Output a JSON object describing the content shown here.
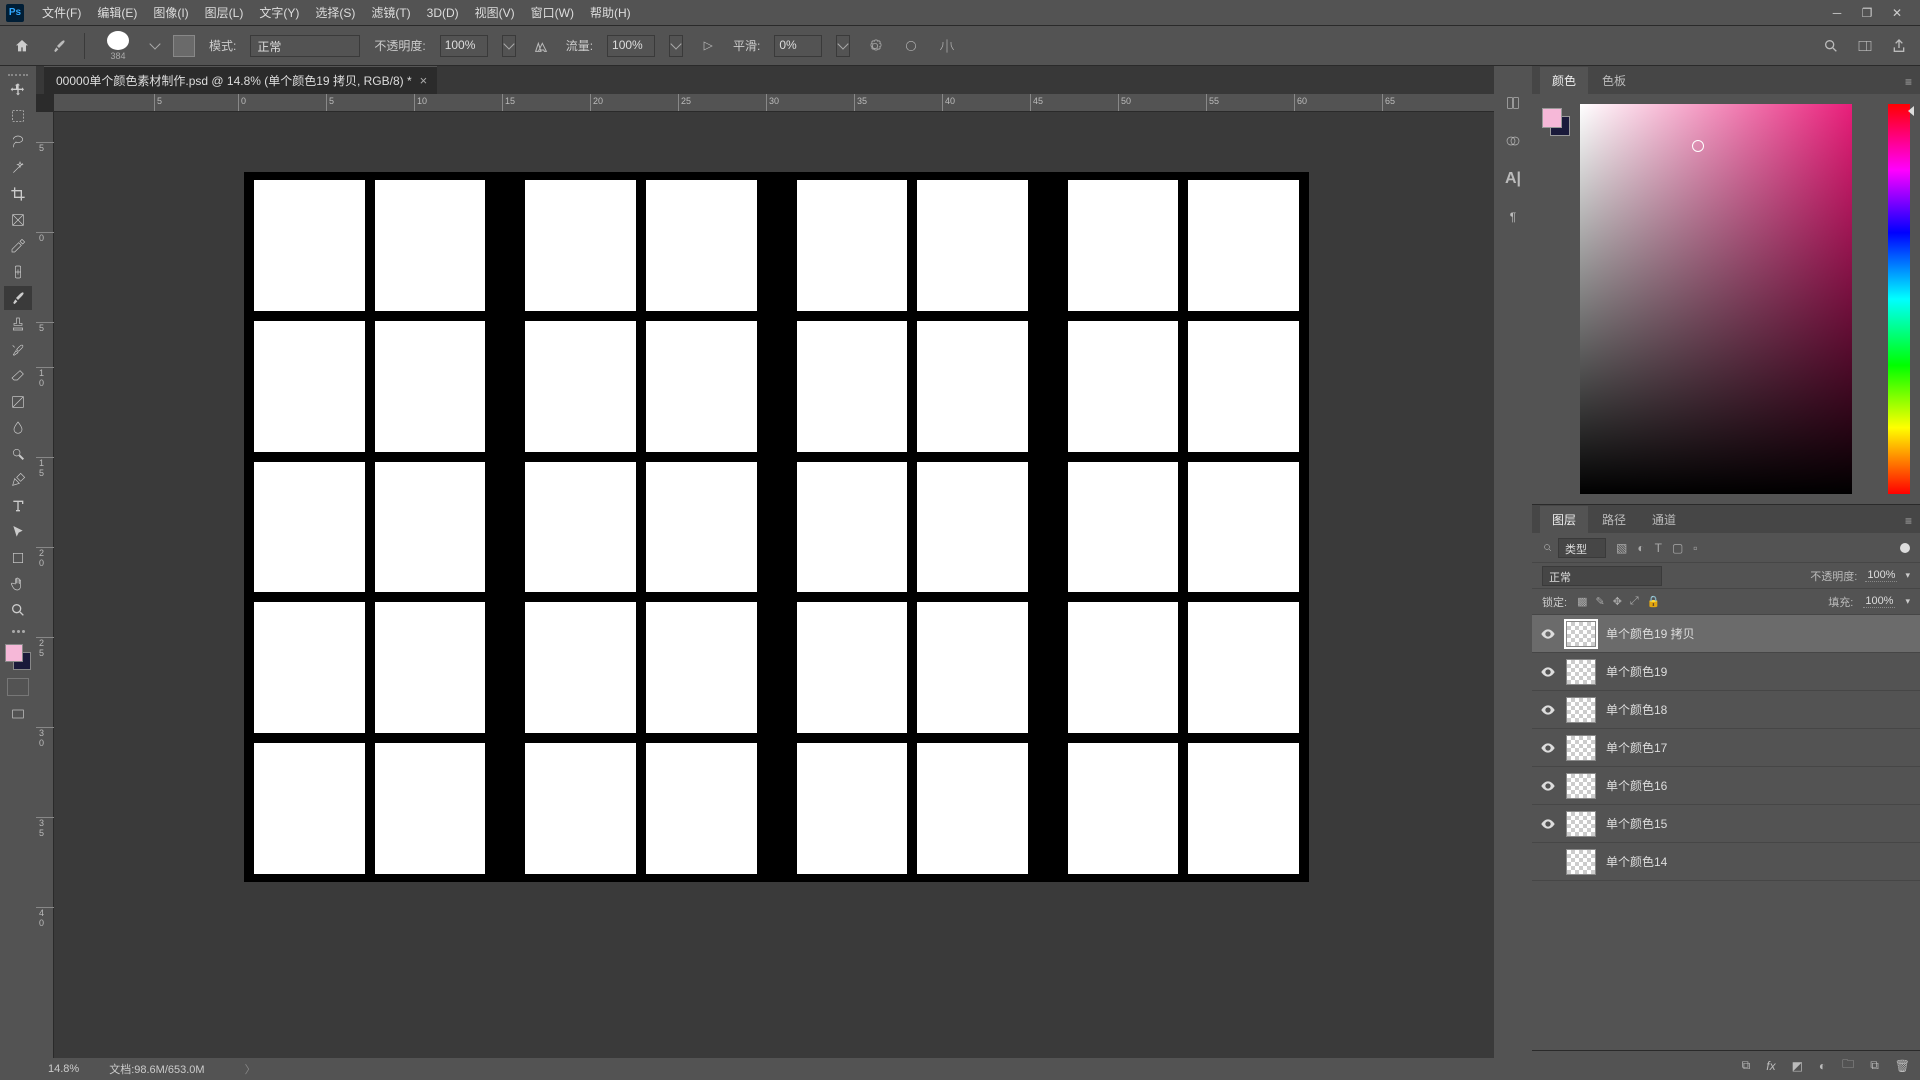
{
  "menu": [
    "文件(F)",
    "编辑(E)",
    "图像(I)",
    "图层(L)",
    "文字(Y)",
    "选择(S)",
    "滤镜(T)",
    "3D(D)",
    "视图(V)",
    "窗口(W)",
    "帮助(H)"
  ],
  "optbar": {
    "brush_size": "384",
    "mode_label": "模式:",
    "mode_value": "正常",
    "opacity_label": "不透明度:",
    "opacity_value": "100%",
    "flow_label": "流量:",
    "flow_value": "100%",
    "smooth_label": "平滑:",
    "smooth_value": "0%"
  },
  "doc": {
    "tab_title": "00000单个颜色素材制作.psd @ 14.8% (单个颜色19 拷贝, RGB/8) *",
    "zoom": "14.8%",
    "docinfo": "文档:98.6M/653.0M"
  },
  "ruler_h": [
    "5",
    "10",
    "15",
    "20",
    "25",
    "30",
    "35",
    "40",
    "45",
    "50",
    "55",
    "60",
    "65"
  ],
  "ruler_h_start": "0",
  "ruler_v": [
    "0",
    "0",
    "5",
    "0",
    "5",
    "0",
    "5",
    "0",
    "5",
    "0",
    "5"
  ],
  "color_tabs": {
    "t1": "颜色",
    "t2": "色板"
  },
  "layer_tabs": {
    "t1": "图层",
    "t2": "路径",
    "t3": "通道"
  },
  "layer_filter": {
    "type_label": "类型"
  },
  "blend": {
    "mode": "正常",
    "opacity_label": "不透明度:",
    "opacity_val": "100%"
  },
  "lock": {
    "label": "锁定:",
    "fill_label": "填充:",
    "fill_val": "100%"
  },
  "layers": [
    {
      "name": "单个颜色19 拷贝",
      "visible": true,
      "selected": true
    },
    {
      "name": "单个颜色19",
      "visible": true,
      "selected": false
    },
    {
      "name": "单个颜色18",
      "visible": true,
      "selected": false
    },
    {
      "name": "单个颜色17",
      "visible": true,
      "selected": false
    },
    {
      "name": "单个颜色16",
      "visible": true,
      "selected": false
    },
    {
      "name": "单个颜色15",
      "visible": true,
      "selected": false
    },
    {
      "name": "单个颜色14",
      "visible": false,
      "selected": false
    }
  ],
  "colors": {
    "fg": "#f6b8d8",
    "bg": "#1a1a3a"
  }
}
